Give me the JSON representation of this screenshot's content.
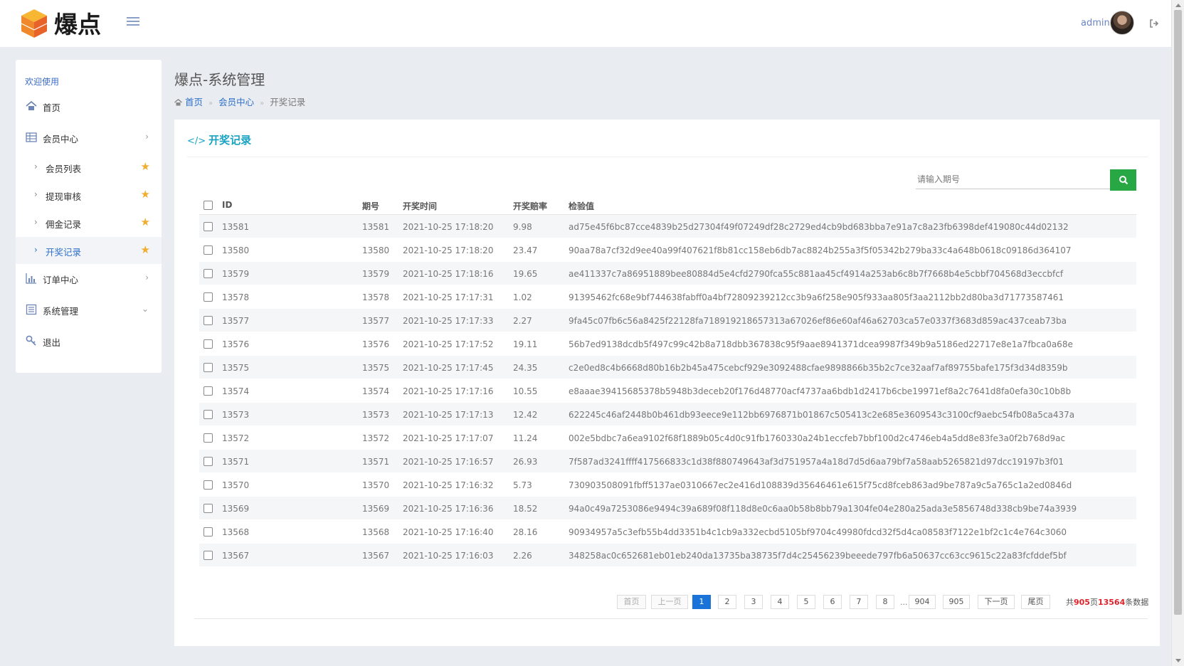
{
  "brand": {
    "logo_text": "爆点"
  },
  "topbar": {
    "admin": "admin"
  },
  "sidebar": {
    "welcome": "欢迎使用",
    "home": "首页",
    "member_center": "会员中心",
    "sub_items": [
      "会员列表",
      "提现审核",
      "佣金记录",
      "开奖记录"
    ],
    "active_sub": "开奖记录",
    "order_center": "订单中心",
    "system_manage": "系统管理",
    "logout": "退出"
  },
  "page": {
    "title": "爆点-系统管理",
    "breadcrumb": [
      "首页",
      "会员中心",
      "开奖记录"
    ]
  },
  "panel": {
    "title": "开奖记录",
    "search_placeholder": "请输入期号"
  },
  "table": {
    "columns": [
      "ID",
      "期号",
      "开奖时间",
      "开奖赔率",
      "检验值"
    ],
    "rows": [
      [
        "13581",
        "13581",
        "2021-10-25 17:18:20",
        "9.98",
        "ad75e45f6bc87cce4839b25d27304f49f07249df28c2729ed4cb9bd683bba7e91a7c8a23fb6398def419080c44d02132"
      ],
      [
        "13580",
        "13580",
        "2021-10-25 17:18:20",
        "23.47",
        "90aa78a7cf32d9ee40a99f407621f8b81cc158eb6db7ac8824b255a3f5f05342b279ba33c4a648b0618c09186d364107"
      ],
      [
        "13579",
        "13579",
        "2021-10-25 17:18:16",
        "19.65",
        "ae411337c7a86951889bee80884d5e4cfd2790fca55c881aa45cf4914a253ab6c8b7f7668b4e5cbbf704568d3eccbfcf"
      ],
      [
        "13578",
        "13578",
        "2021-10-25 17:17:31",
        "1.02",
        "91395462fc68e9bf744638fabff0a4bf72809239212cc3b9a6f258e905f933aa805f3aa2112bb2d80ba3d71773587461"
      ],
      [
        "13577",
        "13577",
        "2021-10-25 17:17:33",
        "2.27",
        "9fa45c07fb6c56a8425f22128fa718919218657313a67026ef86e60af46a62703ca57e0337f3683d859ac437ceab73ba"
      ],
      [
        "13576",
        "13576",
        "2021-10-25 17:17:52",
        "19.11",
        "56b7ed9138dcdb5f497c99c42b8a718dbb367838c95f9aae8941371dcea9987f349b9a5186ed22717e8e1a7fbca0a68e"
      ],
      [
        "13575",
        "13575",
        "2021-10-25 17:17:45",
        "24.35",
        "c2e0ed8c4b6668d80b16b2b45a475cebcf929e3092488cfae9898866b35b2c7ce32aaf7af89755bafe175f3d34d8359b"
      ],
      [
        "13574",
        "13574",
        "2021-10-25 17:17:16",
        "10.55",
        "e8aaae39415685378b5948b3deceb20f176d48770acf4737aa6bdb1d2417b6cbe19971ef8a2c7641d8fa0efa30c10b8b"
      ],
      [
        "13573",
        "13573",
        "2021-10-25 17:17:13",
        "12.42",
        "622245c46af2448b0b461db93eece9e112bb6976871b01867c505413c2e685e3609543c3100cf9aebc54fb08a5ca437a"
      ],
      [
        "13572",
        "13572",
        "2021-10-25 17:17:07",
        "11.24",
        "002e5bdbc7a6ea9102f68f1889b05c4d0c91fb1760330a24b1eccfeb7bbf100d2c4746eb4a5dd8e83fe3a0f2b768d9ac"
      ],
      [
        "13571",
        "13571",
        "2021-10-25 17:16:57",
        "26.93",
        "7f587ad3241ffff417566833c1d38f880749643af3d751957a4a18d7d5d6aa79bf7a58aab5265821d97dcc19197b3f01"
      ],
      [
        "13570",
        "13570",
        "2021-10-25 17:16:32",
        "5.73",
        "730903508091fbff5137ae0310667ec2e416d108839d35646461e615f75cd8fceb863ad9be787a9c5a765c1a2ed0846d"
      ],
      [
        "13569",
        "13569",
        "2021-10-25 17:16:36",
        "18.52",
        "94a0c49a7253086e9494c39a689f08f118d8e0c6aa0b58b8bb79a1304fe04e280a25ada3e5856748d338cb9be74a3939"
      ],
      [
        "13568",
        "13568",
        "2021-10-25 17:16:40",
        "28.16",
        "90934957a5c3efb55b4dd3351b4c1cb9a332ecbd5105bf9704c49980fdcd32f5d4ca08583f7122e1bf2c1c4e764c3060"
      ],
      [
        "13567",
        "13567",
        "2021-10-25 17:16:03",
        "2.26",
        "348258ac0c652681eb01eb240da13735ba38735f7d4c25456239beeede797fb6a50637cc63cc9615c22a83fcfddef5bf"
      ]
    ]
  },
  "pagination": {
    "first": "首页",
    "prev": "上一页",
    "pages": [
      "1",
      "2",
      "3",
      "4",
      "5",
      "6",
      "7",
      "8"
    ],
    "ellipsis": "...",
    "tail_pages": [
      "904",
      "905"
    ],
    "next": "下一页",
    "last": "尾页",
    "total_prefix": "共",
    "total_pages": "905",
    "total_mid": "页",
    "total_records": "13564",
    "total_suffix": "条数据",
    "current": "1"
  },
  "colors": {
    "accent": "#1aa3c2",
    "link": "#2e6fc9",
    "search_button": "#28a745",
    "current_page": "#1a73d9",
    "star": "#f0ad2e"
  }
}
